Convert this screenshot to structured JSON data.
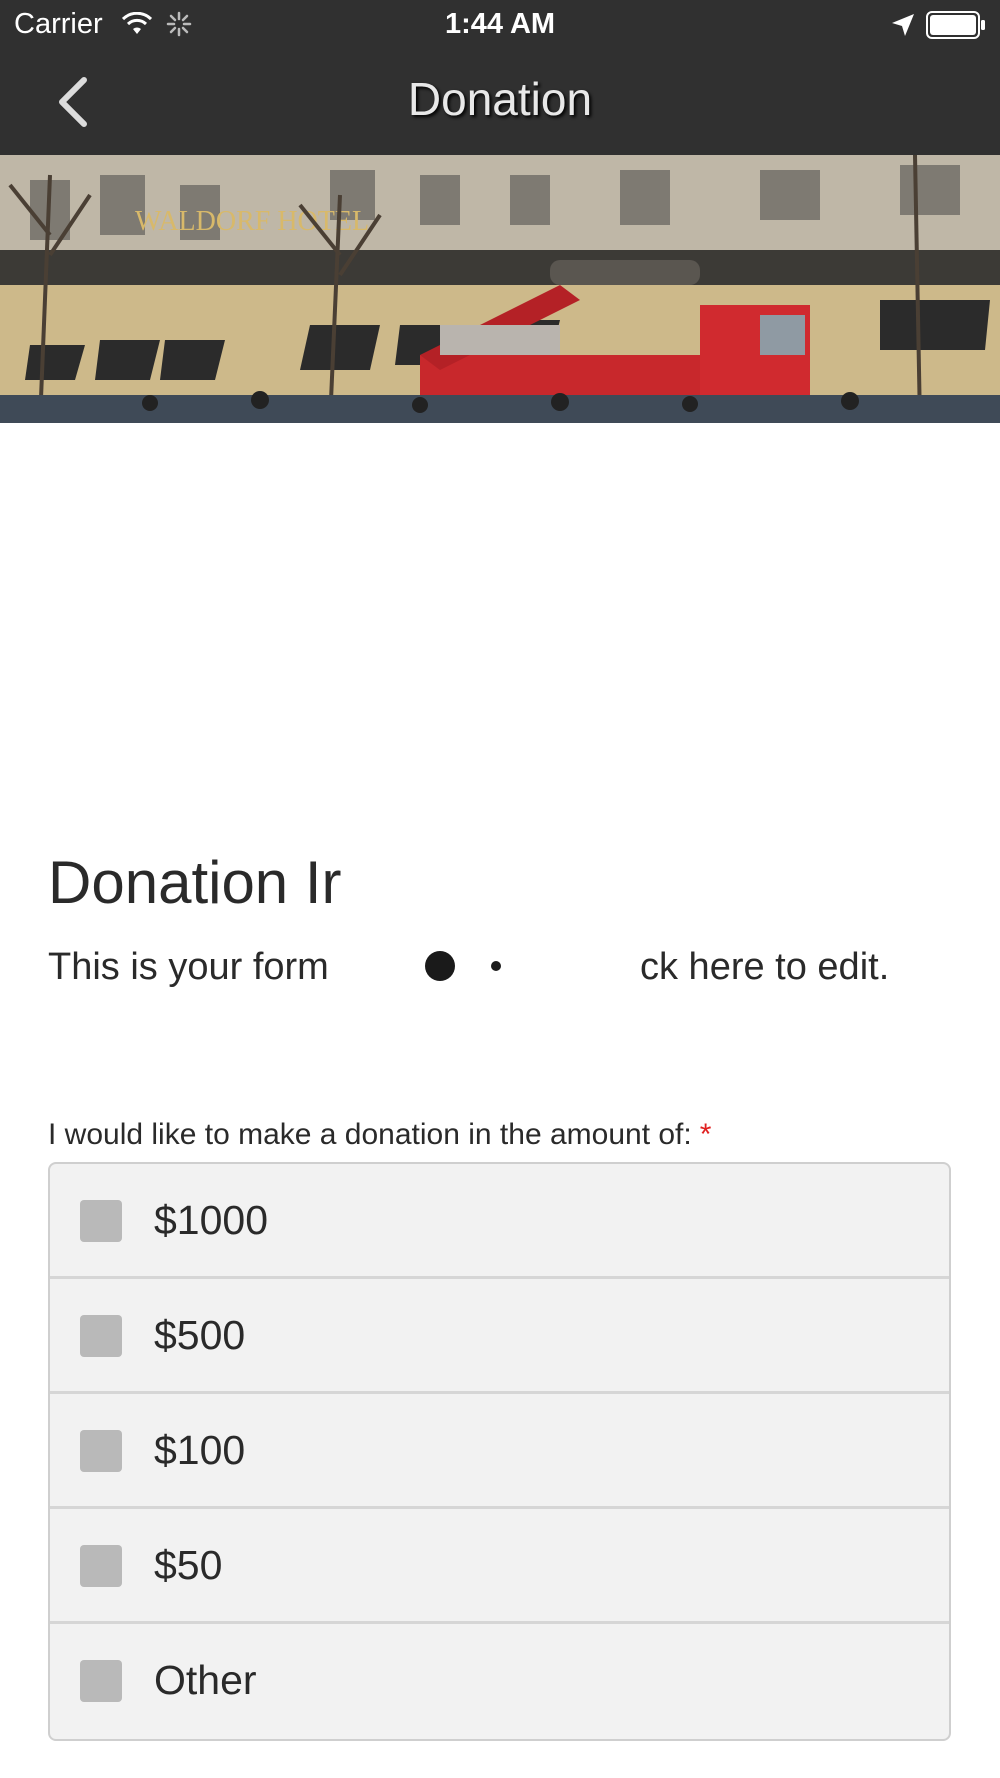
{
  "status_bar": {
    "carrier": "Carrier",
    "time": "1:44 AM",
    "icons": [
      "wifi-icon",
      "activity-spinner-icon",
      "location-arrow-icon",
      "battery-icon"
    ]
  },
  "nav": {
    "title": "Donation",
    "back_icon": "chevron-left-icon"
  },
  "hero": {
    "sign_text": "WALDORF HOTEL"
  },
  "form": {
    "title": "Donation Ir",
    "description_start": "This is your form",
    "description_end": "ck here to edit.",
    "question": "I would like to make a donation in the amount of:",
    "required_marker": "*",
    "options": [
      {
        "label": "$1000",
        "checked": false
      },
      {
        "label": "$500",
        "checked": false
      },
      {
        "label": "$100",
        "checked": false
      },
      {
        "label": "$50",
        "checked": false
      },
      {
        "label": "Other",
        "checked": false
      }
    ]
  },
  "colors": {
    "bar_background": "#303030",
    "option_background": "#f2f2f2",
    "checkbox": "#b9b9b9",
    "required": "#e02020"
  }
}
